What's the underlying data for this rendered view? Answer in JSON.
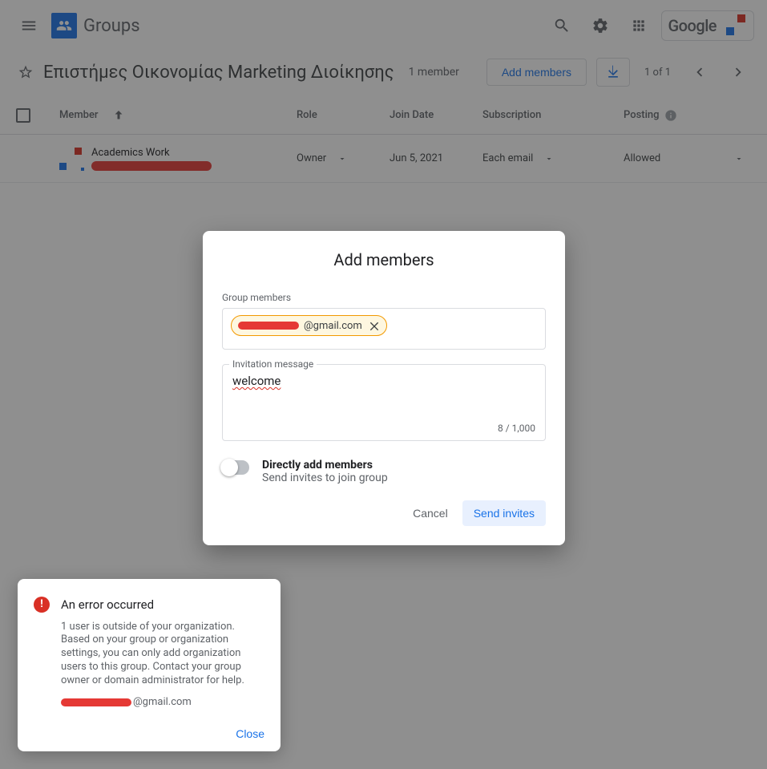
{
  "header": {
    "product_name": "Groups",
    "google_label": "Google"
  },
  "group": {
    "name": "Επιστήμες Οικονομίας Marketing Διοίκησης",
    "member_summary": "1 member",
    "add_members_label": "Add members",
    "pager": "1 of 1"
  },
  "table": {
    "columns": {
      "member": "Member",
      "role": "Role",
      "join_date": "Join Date",
      "subscription": "Subscription",
      "posting": "Posting"
    },
    "rows": [
      {
        "name": "Academics Work",
        "role": "Owner",
        "join_date": "Jun 5, 2021",
        "subscription": "Each email",
        "posting": "Allowed"
      }
    ]
  },
  "dialog": {
    "title": "Add members",
    "group_members_label": "Group members",
    "chip_suffix": "@gmail.com",
    "invitation_label": "Invitation message",
    "invitation_text": "welcome",
    "char_count": "8 / 1,000",
    "switch_title": "Directly add members",
    "switch_subtitle": "Send invites to join group",
    "cancel": "Cancel",
    "send": "Send invites"
  },
  "error": {
    "title": "An error occurred",
    "body": "1 user is outside of your organization. Based on your group or organization settings, you can only add organization users to this group. Contact your group owner or domain administrator for help.",
    "email_suffix": "@gmail.com",
    "close": "Close"
  }
}
